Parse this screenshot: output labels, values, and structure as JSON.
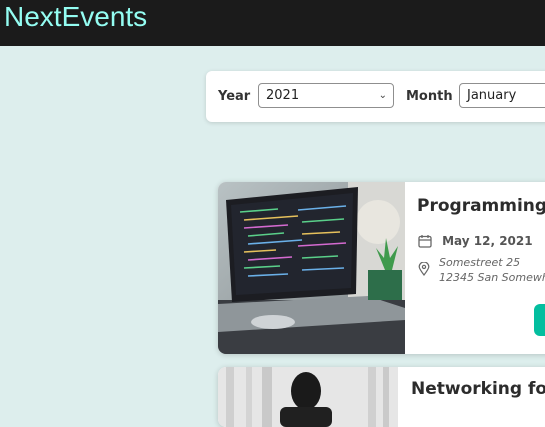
{
  "header": {
    "logo": "NextEvents"
  },
  "filter": {
    "year_label": "Year",
    "year_value": "2021",
    "month_label": "Month",
    "month_value": "January"
  },
  "events": [
    {
      "title": "Programming fo",
      "date": "May 12, 2021",
      "address_line1": "Somestreet 25",
      "address_line2": "12345 San Somewh"
    },
    {
      "title": "Networking for i"
    }
  ],
  "colors": {
    "header_bg": "#1b1b1b",
    "logo": "#94fdf2",
    "page_bg": "#ddeeed",
    "accent": "#03be9f"
  },
  "icons": [
    "calendar-icon",
    "location-pin-icon",
    "chevron-down-icon"
  ]
}
